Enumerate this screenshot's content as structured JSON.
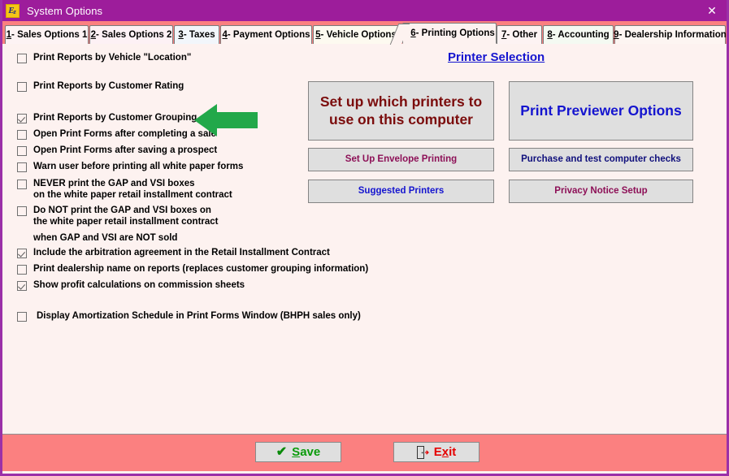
{
  "window": {
    "title": "System Options",
    "icon": "ez-logo-icon",
    "close_label": "✕",
    "accent_purple": "#9d1d9b",
    "accent_salmon": "#fb8080",
    "page_background": "#fdf2f0"
  },
  "tabs": [
    {
      "num": "1",
      "label": " - Sales Options 1",
      "active": false
    },
    {
      "num": "2",
      "label": " - Sales Options 2",
      "active": false
    },
    {
      "num": "3",
      "label": " - Taxes",
      "active": false
    },
    {
      "num": "4",
      "label": " - Payment Options",
      "active": false
    },
    {
      "num": "5",
      "label": " - Vehicle Options",
      "active": false
    },
    {
      "num": "6",
      "label": " - Printing Options",
      "active": true
    },
    {
      "num": "7",
      "label": " - Other",
      "active": false
    },
    {
      "num": "8",
      "label": " - Accounting",
      "active": false
    },
    {
      "num": "9",
      "label": " - Dealership Information",
      "active": false
    }
  ],
  "options": [
    {
      "label": "Print Reports by Vehicle \"Location\"",
      "checked": false
    },
    {
      "label": "Print Reports by Customer Rating",
      "checked": false
    },
    {
      "label": "Print Reports by Customer Grouping",
      "checked": true
    },
    {
      "label": "Open Print Forms after completing a sale",
      "checked": false
    },
    {
      "label": "Open Print Forms after saving a prospect",
      "checked": false
    },
    {
      "label": "Warn user before printing all white paper forms",
      "checked": false
    },
    {
      "label": "NEVER print the GAP and VSI boxes",
      "checked": false
    },
    {
      "label": "Do NOT print the GAP and VSI boxes on",
      "checked": false
    },
    {
      "label": "Include the arbitration agreement in the Retail Installment Contract",
      "checked": true
    },
    {
      "label": "Print dealership name on reports (replaces customer grouping information)",
      "checked": false
    },
    {
      "label": "Show profit calculations on commission sheets",
      "checked": true
    },
    {
      "label": "Display Amortization Schedule in Print Forms Window (BHPH sales only)",
      "checked": false
    }
  ],
  "option_continuations": {
    "never_gap_line2": "on the white paper retail installment contract",
    "donot_gap_line2": "the white paper retail installment contract",
    "donot_gap_line3": "when GAP and VSI are NOT sold"
  },
  "annotation": {
    "arrow": "left-arrow-annotation",
    "color": "#22a84a"
  },
  "printer_panel": {
    "heading": "Printer Selection",
    "heading_color": "#1414cf",
    "buttons": [
      {
        "label": "Set up which printers to use on this computer",
        "color": "#7b0c0c",
        "size": "big"
      },
      {
        "label": "Print Previewer Options",
        "color": "#1414cf",
        "size": "big"
      },
      {
        "label": "Set Up Envelope Printing",
        "color": "#8d1057",
        "size": "small"
      },
      {
        "label": "Purchase and test computer checks",
        "color": "#10107c",
        "size": "small"
      },
      {
        "label": "Suggested Printers",
        "color": "#1414cf",
        "size": "small"
      },
      {
        "label": "Privacy Notice Setup",
        "color": "#8d1057",
        "size": "small"
      }
    ]
  },
  "footer": {
    "save": {
      "label_before": "S",
      "label_after": "ave",
      "icon": "check-icon",
      "color": "#0a9b0a"
    },
    "exit": {
      "label_before": "E",
      "accel": "x",
      "label_after": "it",
      "icon": "door-exit-icon",
      "color": "#e50000"
    }
  }
}
